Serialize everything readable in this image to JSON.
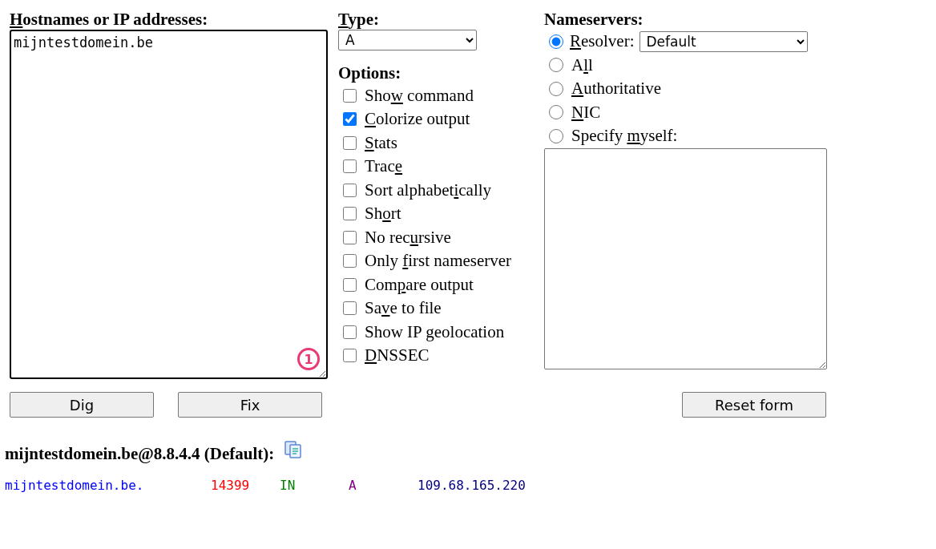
{
  "hostnames": {
    "label": {
      "key": "H",
      "post": "ostnames or IP addresses:"
    },
    "value": "mijntestdomein.be",
    "badge": "1"
  },
  "type": {
    "label": {
      "key": "T",
      "post": "ype:"
    },
    "value": "A"
  },
  "options": {
    "heading": "Options:",
    "items": [
      {
        "label": {
          "pre": "Sho",
          "key": "w",
          "post": " command"
        },
        "checked": false
      },
      {
        "label": {
          "key": "C",
          "post": "olorize output"
        },
        "checked": true
      },
      {
        "label": {
          "key": "S",
          "post": "tats"
        },
        "checked": false
      },
      {
        "label": {
          "pre": "Trac",
          "key": "e"
        },
        "checked": false
      },
      {
        "label": {
          "pre": "Sort alphabet",
          "key": "i",
          "post": "cally"
        },
        "checked": false
      },
      {
        "label": {
          "pre": "Sh",
          "key": "o",
          "post": "rt"
        },
        "checked": false
      },
      {
        "label": {
          "pre": "No rec",
          "key": "u",
          "post": "rsive"
        },
        "checked": false
      },
      {
        "label": {
          "pre": "Only ",
          "key": "f",
          "post": "irst nameserver"
        },
        "checked": false
      },
      {
        "label": {
          "pre": "Com",
          "key": "p",
          "post": "are output"
        },
        "checked": false
      },
      {
        "label": {
          "pre": "Sa",
          "key": "v",
          "post": "e to file"
        },
        "checked": false
      },
      {
        "label": {
          "pre": "Show IP geolocation"
        },
        "checked": false
      },
      {
        "label": {
          "key": "D",
          "post": "NSSEC"
        },
        "checked": false
      }
    ]
  },
  "nameservers": {
    "heading": "Nameservers:",
    "items": [
      {
        "kind": "select",
        "label": {
          "key": "R",
          "post": "esolver:"
        },
        "selected": true,
        "value": "Default"
      },
      {
        "kind": "plain",
        "label": {
          "pre": "A",
          "key": "l",
          "post": "l"
        },
        "selected": false
      },
      {
        "kind": "plain",
        "label": {
          "key": "A",
          "post": "uthoritative"
        },
        "selected": false
      },
      {
        "kind": "plain",
        "label": {
          "key": "N",
          "post": "IC"
        },
        "selected": false
      },
      {
        "kind": "textarea",
        "label": {
          "pre": "Specify ",
          "key": "m",
          "post": "yself:"
        },
        "selected": false
      }
    ]
  },
  "buttons": [
    "Dig",
    "Fix"
  ],
  "reset_button": "Reset form",
  "result": {
    "heading": "mijntestdomein.be@8.8.4.4 (Default):",
    "records": [
      {
        "fields": [
          {
            "text": "mijntestdomein.be.",
            "color": "#0000ff"
          },
          {
            "text": "14399",
            "color": "#ff0000"
          },
          {
            "text": "IN",
            "color": "#008000"
          },
          {
            "text": "A",
            "color": "#800080"
          },
          {
            "text": "109.68.165.220",
            "color": "#000080"
          }
        ]
      }
    ]
  }
}
